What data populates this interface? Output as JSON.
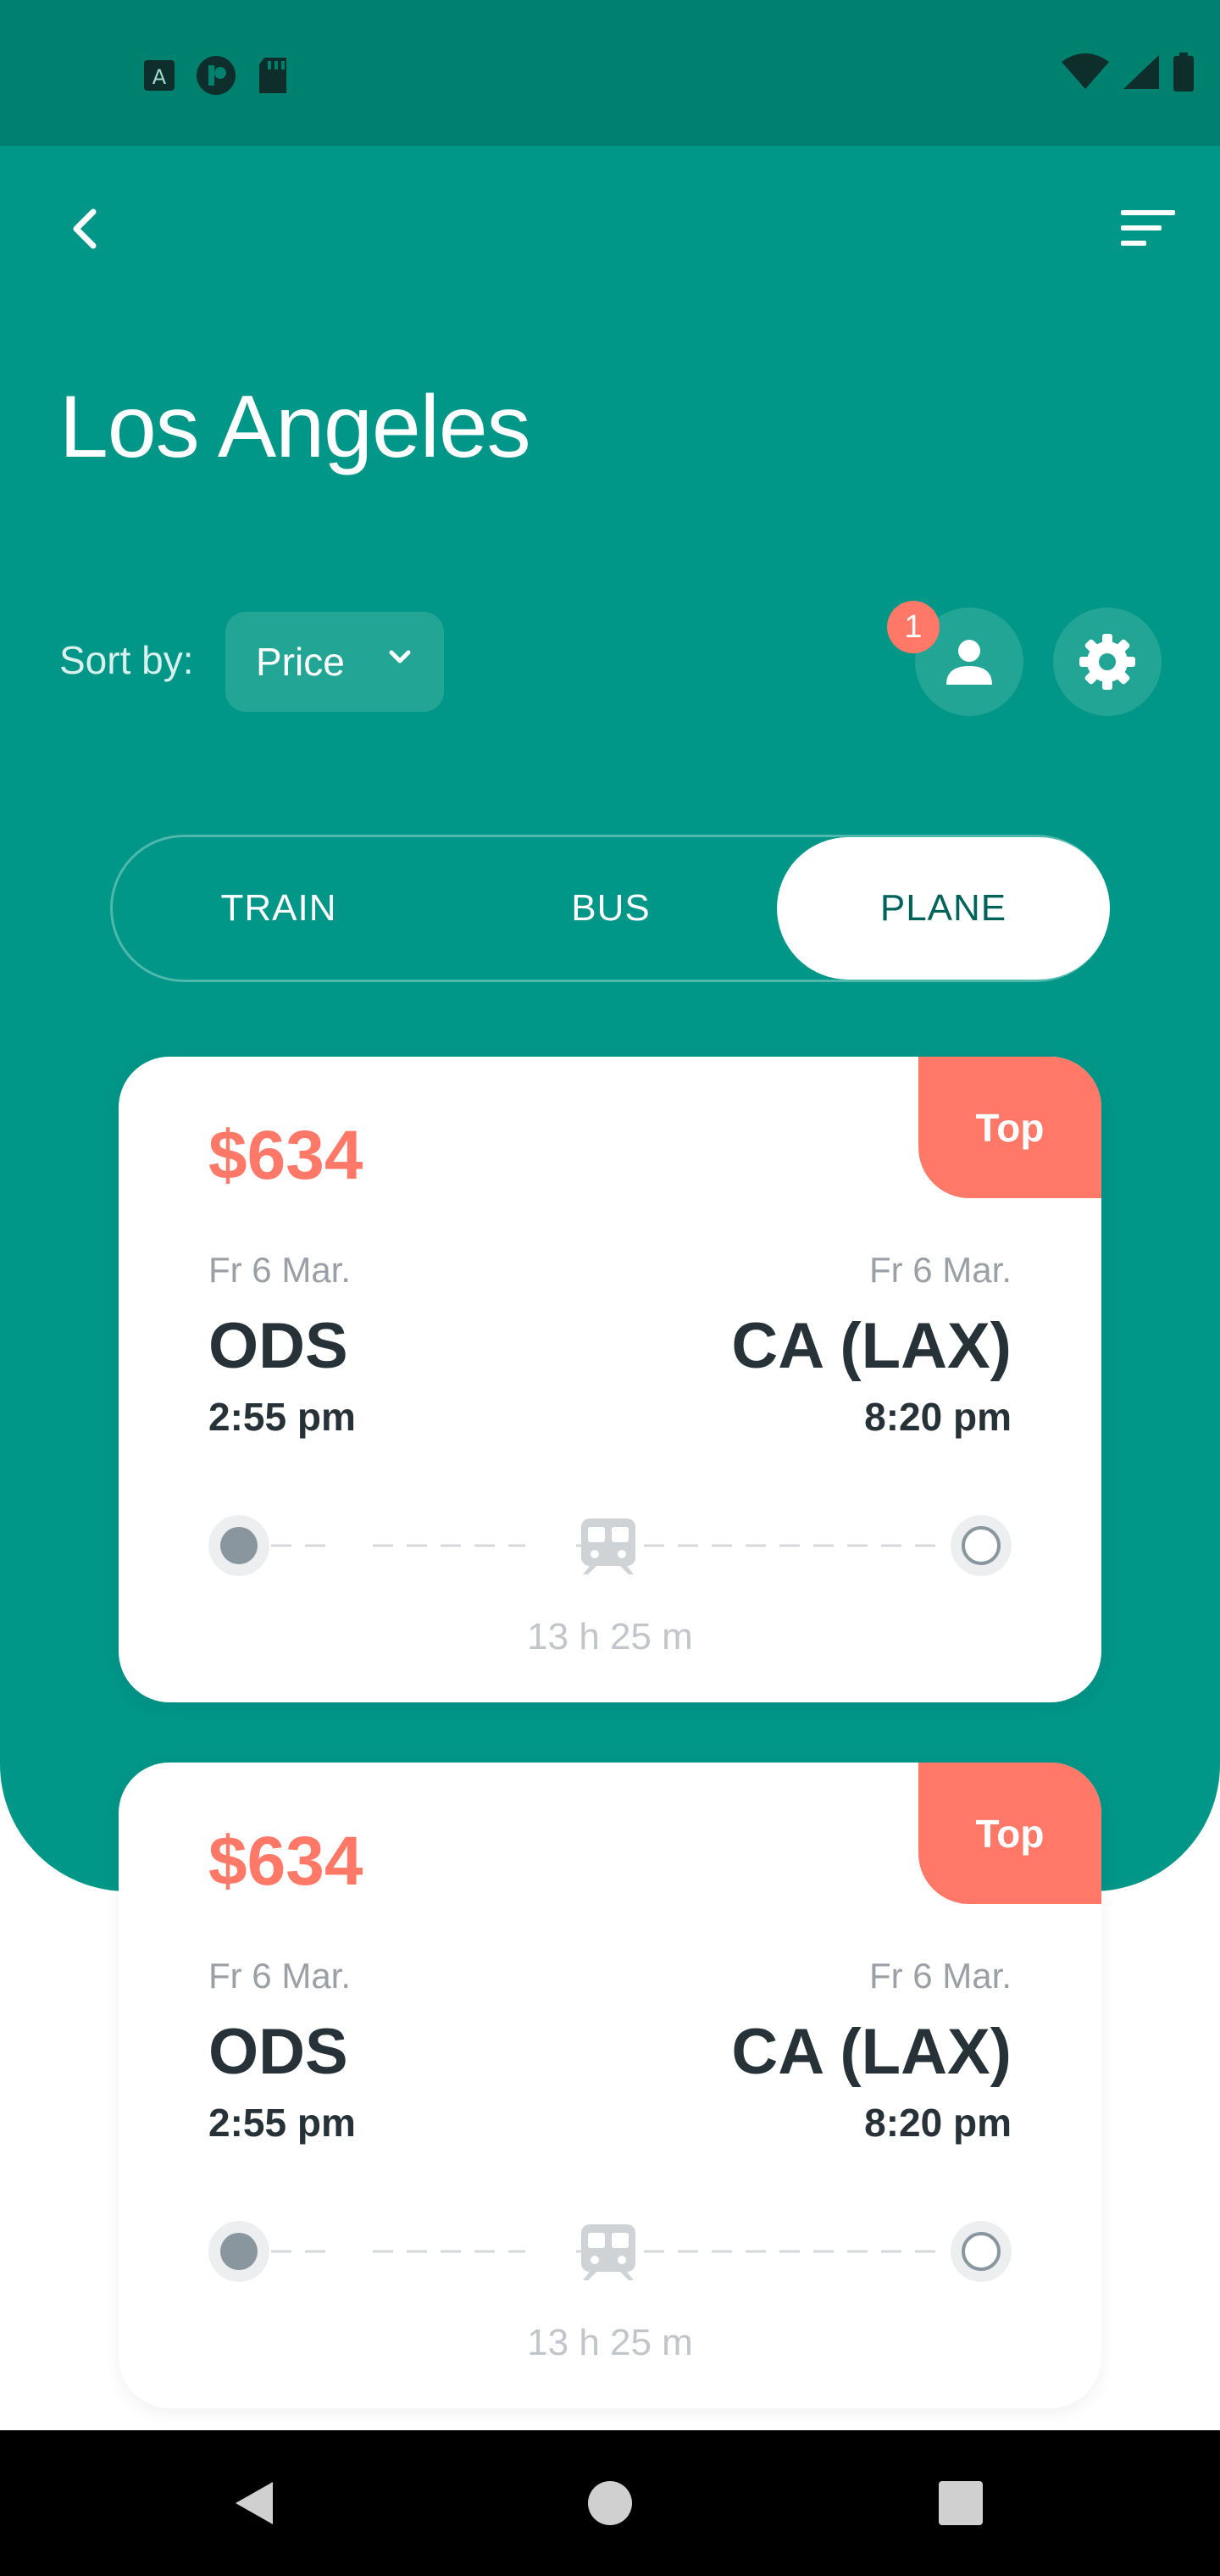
{
  "header": {
    "title": "Los Angeles",
    "sort_label": "Sort by:",
    "sort_value": "Price",
    "notification_count": "1"
  },
  "tabs": [
    {
      "label": "TRAIN",
      "selected": false
    },
    {
      "label": "BUS",
      "selected": false
    },
    {
      "label": "PLANE",
      "selected": true
    }
  ],
  "cards": [
    {
      "badge": "Top",
      "price": "$634",
      "from": {
        "date": "Fr 6 Mar.",
        "city": "ODS",
        "time": "2:55 pm"
      },
      "to": {
        "date": "Fr 6 Mar.",
        "city": "CA (LAX)",
        "time": "8:20 pm"
      },
      "duration": "13 h 25 m"
    },
    {
      "badge": "Top",
      "price": "$634",
      "from": {
        "date": "Fr 6 Mar.",
        "city": "ODS",
        "time": "2:55 pm"
      },
      "to": {
        "date": "Fr 6 Mar.",
        "city": "CA (LAX)",
        "time": "8:20 pm"
      },
      "duration": "13 h 25 m"
    }
  ],
  "icons": {
    "back": "chevron-left-icon",
    "filter": "sort-lines-icon",
    "sort_dropdown": "chevron-down-icon",
    "profile": "person-icon",
    "settings": "gear-icon",
    "transport": "train-icon",
    "nav_back": "triangle-back-icon",
    "nav_home": "circle-home-icon",
    "nav_recent": "square-recents-icon"
  },
  "colors": {
    "primary": "#009688",
    "status_bar": "#00806f",
    "accent": "#ff7868",
    "surface": "#ffffff",
    "text_dark": "#263238",
    "text_muted": "#9aa0a6"
  }
}
